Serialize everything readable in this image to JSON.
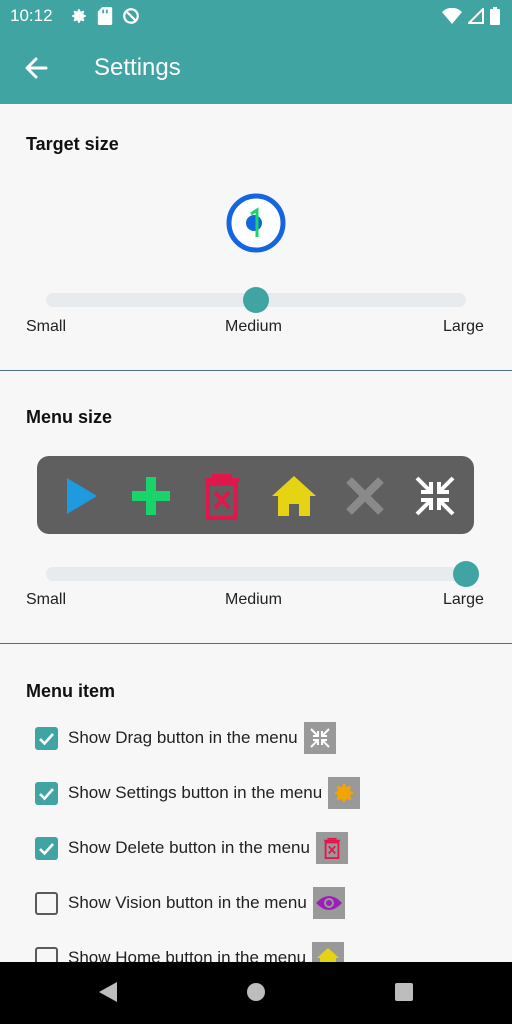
{
  "status_bar": {
    "time": "10:12",
    "icons": [
      "gear-icon",
      "sd-card-icon",
      "blocked-icon"
    ],
    "right_icons": [
      "wifi-icon",
      "signal-icon",
      "battery-icon"
    ]
  },
  "app_bar": {
    "back_icon": "arrow-left-icon",
    "title": "Settings"
  },
  "target_size": {
    "title": "Target size",
    "slider_value": 0.5,
    "labels": {
      "small": "Small",
      "medium": "Medium",
      "large": "Large"
    }
  },
  "menu_size": {
    "title": "Menu size",
    "preview_icons": [
      "play-icon",
      "plus-icon",
      "trash-icon",
      "home-icon",
      "close-icon",
      "collapse-icon"
    ],
    "slider_value": 1.0,
    "labels": {
      "small": "Small",
      "medium": "Medium",
      "large": "Large"
    }
  },
  "menu_item": {
    "title": "Menu item",
    "items": [
      {
        "label": "Show Drag button in the menu",
        "checked": true,
        "icon": "drag-icon"
      },
      {
        "label": "Show Settings button in the menu",
        "checked": true,
        "icon": "gear-icon"
      },
      {
        "label": "Show Delete button in the menu",
        "checked": true,
        "icon": "trash-icon"
      },
      {
        "label": "Show Vision button in the menu",
        "checked": false,
        "icon": "eye-icon"
      },
      {
        "label": "Show Home button in the menu",
        "checked": false,
        "icon": "home-icon"
      }
    ]
  },
  "nav_bar": {
    "icons": [
      "back-triangle-icon",
      "home-circle-icon",
      "recents-square-icon"
    ]
  },
  "colors": {
    "accent": "#40a4a2",
    "play": "#1e9be0",
    "plus": "#19d46a",
    "delete": "#e0174a",
    "home": "#e6d314",
    "close": "#8a8a8a",
    "settings": "#f2a500",
    "vision": "#9b1fb8",
    "target_ring": "#1466e0"
  }
}
